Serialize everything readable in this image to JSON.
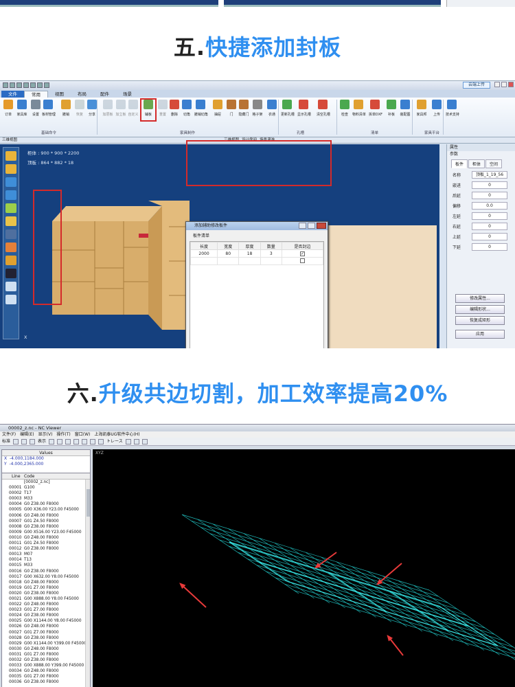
{
  "section5": {
    "num": "五.",
    "text": "快捷添加封板"
  },
  "section6": {
    "num": "六.",
    "text": "升级共边切割，加工效率提高20%"
  },
  "app": {
    "cloud": "云端上传",
    "tabs": [
      "文件",
      "常用",
      "视图",
      "布局",
      "配件",
      "场景"
    ],
    "ribbon_items": [
      "订单",
      "家具库",
      "设置",
      "板材管理",
      "撤销",
      "恢复",
      "分享",
      "加层板",
      "加立板",
      "自定义",
      "辅板",
      "重置",
      "删除",
      "切角",
      "撤销切角",
      "抽屉",
      "门",
      "隐藏门",
      "格子架",
      "衣通",
      "更新孔槽",
      "显示孔槽",
      "清空孔槽",
      "检查",
      "物料清单",
      "拆单DXF",
      "补板",
      "装配图",
      "家具邦",
      "上传",
      "技术支持"
    ],
    "groups": [
      "基础命令",
      "家具制作",
      "孔槽",
      "清单",
      "家具平台"
    ],
    "viewtabs": [
      "三维视图",
      "三维视图",
      "设计房间",
      "场景漫游"
    ],
    "cabinet_size": "柜体 : 900 * 900 * 2200",
    "top_size": "顶板 : 864 * 882 * 18",
    "axis_x": "X",
    "face_label": "F",
    "dialog": {
      "title": "添加辅助修改板件",
      "group": "板件清单",
      "headers": [
        "长度",
        "宽度",
        "厚度",
        "数量",
        "是否封边"
      ],
      "rows": [
        [
          "2000",
          "80",
          "18",
          "3",
          "✓"
        ],
        [
          "",
          "",
          "",
          "",
          ""
        ]
      ],
      "add_label": "添加"
    },
    "props": {
      "header": "属性",
      "sub": "参数",
      "tabs": [
        "板件",
        "柜体",
        "空间"
      ],
      "fields": [
        {
          "k": "名称",
          "v": "顶板_1_19_56"
        },
        {
          "k": "嵌进",
          "v": "0"
        },
        {
          "k": "后延",
          "v": "0"
        },
        {
          "k": "偏移",
          "v": "0.0"
        },
        {
          "k": "左延",
          "v": "0"
        },
        {
          "k": "右延",
          "v": "0"
        },
        {
          "k": "上延",
          "v": "0"
        },
        {
          "k": "下延",
          "v": "0"
        }
      ],
      "buttons": [
        "修改属性...",
        "编辑形状...",
        "恢复成矩形",
        "应用"
      ]
    }
  },
  "viewer": {
    "title": "00002_z.nc - NC Viewer",
    "menu": [
      "文件(F)",
      "编辑(E)",
      "显示(V)",
      "操作(T)",
      "窗口(W)",
      "上海凯泰UG软件中心(H)"
    ],
    "toolbar": [
      "标准",
      "表示",
      "トレース"
    ],
    "values_header": "Values",
    "x_label": "X",
    "x_value": "-4.000,1184.000",
    "y_label": "Y",
    "y_value": "-4.000,2365.000",
    "code_headers": [
      "Line",
      "Code"
    ],
    "file_line": "[00002_z.nc]",
    "code_lines": [
      [
        "00001",
        "G100"
      ],
      [
        "00002",
        "T17"
      ],
      [
        "00003",
        "M33"
      ],
      [
        "00004",
        "G0 Z38.00 F8000"
      ],
      [
        "00005",
        "G00 X36.00 Y23.00 F45000"
      ],
      [
        "00006",
        "G0 Z48.00 F8000"
      ],
      [
        "00007",
        "G01 Z4.50 F8000"
      ],
      [
        "00008",
        "G0 Z38.00 F8000"
      ],
      [
        "00009",
        "G00 X516.00 Y23.00 F45000"
      ],
      [
        "00010",
        "G0 Z48.00 F8000"
      ],
      [
        "00011",
        "G01 Z4.50 F8000"
      ],
      [
        "00012",
        "G0 Z38.00 F8000"
      ],
      [
        "00013",
        "M07"
      ],
      [
        "00014",
        "T13"
      ],
      [
        "00015",
        "M33"
      ],
      [
        "00016",
        "G0 Z38.00 F8000"
      ],
      [
        "00017",
        "G00 X632.00 Y8.00 F45000"
      ],
      [
        "00018",
        "G0 Z48.00 F8000"
      ],
      [
        "00019",
        "G01 Z7.00 F8000"
      ],
      [
        "00020",
        "G0 Z38.00 F8000"
      ],
      [
        "00021",
        "G00 X888.00 Y8.00 F45000"
      ],
      [
        "00022",
        "G0 Z48.00 F8000"
      ],
      [
        "00023",
        "G01 Z7.00 F8000"
      ],
      [
        "00024",
        "G0 Z38.00 F8000"
      ],
      [
        "00025",
        "G00 X1144.00 Y8.00 F45000"
      ],
      [
        "00026",
        "G0 Z48.00 F8000"
      ],
      [
        "00027",
        "G01 Z7.00 F8000"
      ],
      [
        "00028",
        "G0 Z38.00 F8000"
      ],
      [
        "00029",
        "G00 X1144.00 Y399.00 F45000"
      ],
      [
        "00030",
        "G0 Z48.00 F8000"
      ],
      [
        "00031",
        "G01 Z7.00 F8000"
      ],
      [
        "00032",
        "G0 Z38.00 F8000"
      ],
      [
        "00033",
        "G00 X888.00 Y399.00 F45000"
      ],
      [
        "00034",
        "G0 Z48.00 F8000"
      ],
      [
        "00035",
        "G01 Z7.00 F8000"
      ],
      [
        "00036",
        "G0 Z38.00 F8000"
      ]
    ],
    "canvas_label": "XYZ"
  },
  "colors": {
    "accent": "#2f8ff0",
    "highlight": "#d42a2a",
    "wood": "#d8ad6b",
    "viewport": "#15407e",
    "grid": "#1fb9b9"
  }
}
